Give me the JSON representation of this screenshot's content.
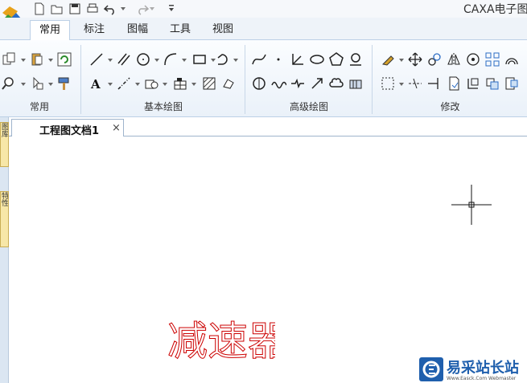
{
  "app": {
    "title": "CAXA电子图"
  },
  "quick_access": {
    "icons": [
      "new-file-icon",
      "open-folder-icon",
      "save-icon",
      "print-icon",
      "undo-icon",
      "redo-icon",
      "customize-icon"
    ]
  },
  "ribbon_tabs": [
    "常用",
    "标注",
    "图幅",
    "工具",
    "视图"
  ],
  "active_tab": "常用",
  "ribbon_groups": {
    "group1": "常用",
    "basic_draw": "基本绘图",
    "advanced_draw": "高级绘图",
    "modify": "修改"
  },
  "side_panels": [
    "图库",
    "特性"
  ],
  "document_tab": {
    "title": "工程图文档1",
    "close": "×"
  },
  "canvas": {
    "text": "减速器",
    "text_color": "#cc0000"
  },
  "watermark": {
    "name": "易采站长站",
    "url": "Www.Easck.Com Webmaster"
  },
  "colors": {
    "accent": "#1f5fad",
    "ribbon_border": "#bcd0e6"
  }
}
